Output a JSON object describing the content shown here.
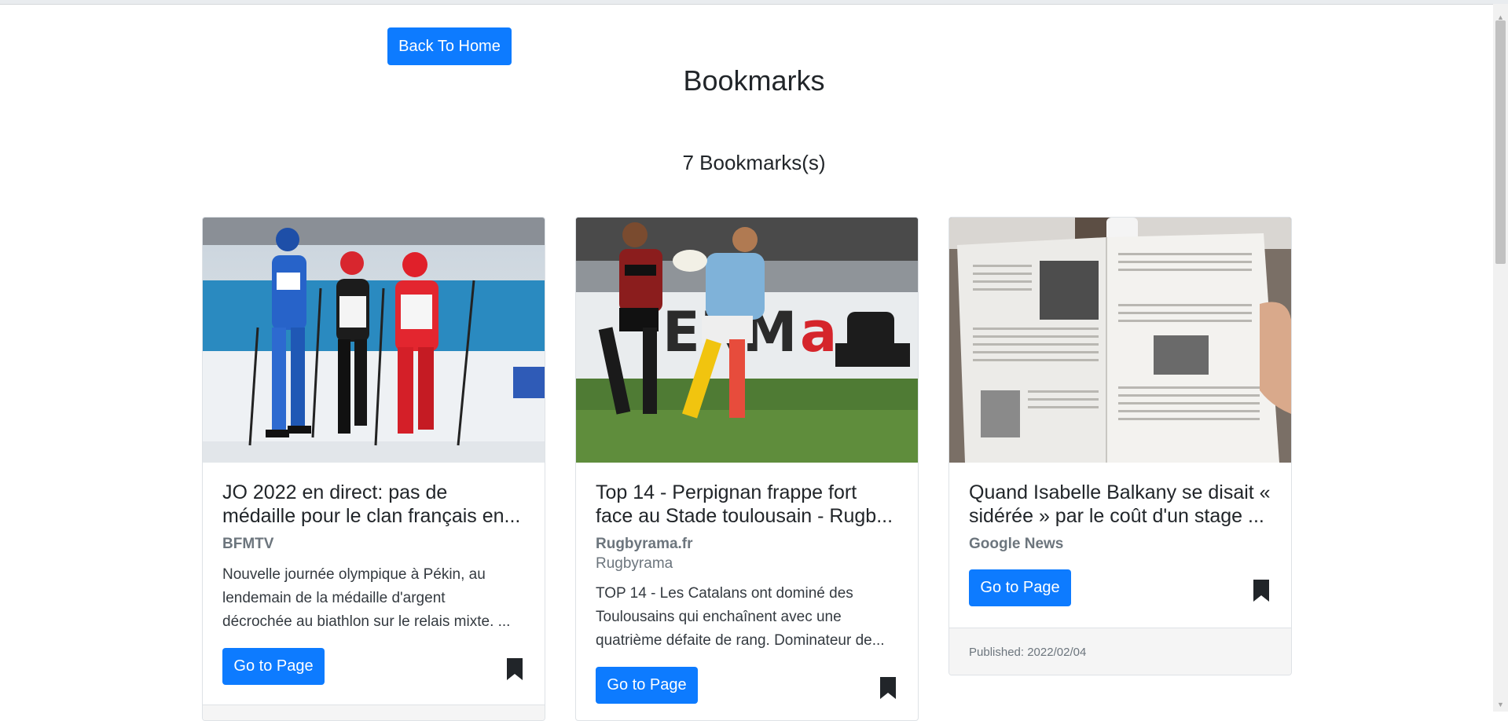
{
  "header": {
    "back_label": "Back To Home",
    "title": "Bookmarks",
    "count_label": "7 Bookmarks(s)"
  },
  "cards": [
    {
      "title_line1": "JO 2022 en direct: pas de",
      "title_line2": "médaille pour le clan français en...",
      "source": "BFMTV",
      "desc_line1": "Nouvelle journée olympique à Pékin, au",
      "desc_line2": "lendemain de la médaille d'argent",
      "desc_line3": "décrochée au biathlon sur le relais mixte. ...",
      "button_label": "Go to Page",
      "image_icon": "cross-country-skiing-photo"
    },
    {
      "title_line1": "Top 14 - Perpignan frappe fort",
      "title_line2": "face au Stade toulousain - Rugb...",
      "source": "Rugbyrama.fr",
      "sub_source": "Rugbyrama",
      "desc_line1": "TOP 14 - Les Catalans ont dominé des",
      "desc_line2": "Toulousains qui enchaînent avec une",
      "desc_line3": "quatrième défaite de rang. Dominateur de...",
      "button_label": "Go to Page",
      "image_icon": "rugby-match-photo"
    },
    {
      "title_line1": "Quand Isabelle Balkany se disait «",
      "title_line2": "sidérée » par le coût d'un stage ...",
      "source": "Google News",
      "button_label": "Go to Page",
      "published": "Published: 2022/02/04",
      "image_icon": "newspaper-photo"
    }
  ],
  "colors": {
    "primary": "#0d7bff",
    "muted": "#6c757d",
    "text": "#212529",
    "bookmark": "#212529"
  },
  "icons": {
    "bookmark": "bookmark-filled-icon",
    "scroll_up": "scroll-up-arrow-icon",
    "scroll_down": "scroll-down-arrow-icon"
  }
}
